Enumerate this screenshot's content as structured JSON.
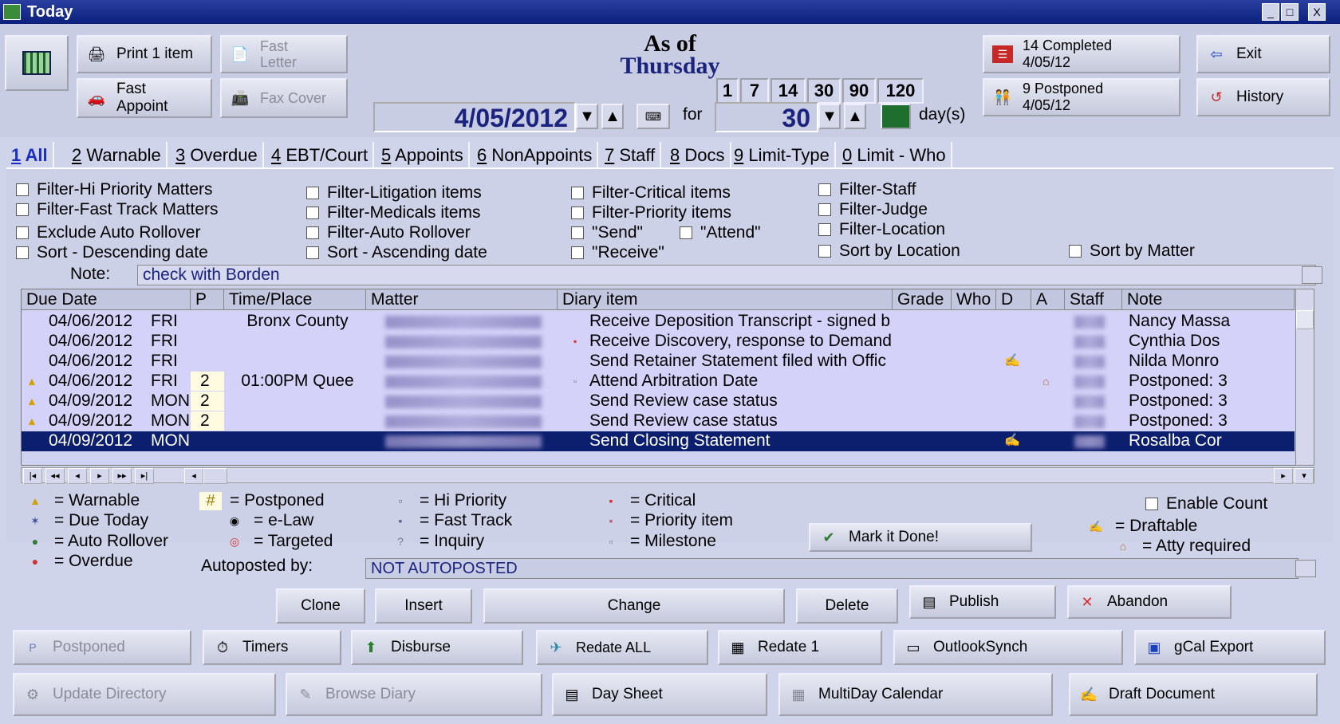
{
  "window": {
    "title": "Today",
    "minimize": "_",
    "maximize": "□",
    "close": "X"
  },
  "toolbar": {
    "print_label": "Print 1 item",
    "fast_letter_label": "Fast Letter",
    "fast_appoint_label": "Fast Appoint",
    "fax_cover_label": "Fax Cover",
    "as_of_label": "As of",
    "weekday": "Thursday",
    "date_value": "4/05/2012",
    "for_label": "for",
    "days_value": "30",
    "days_label": "day(s)",
    "quick_days": [
      "1",
      "7",
      "14",
      "30",
      "90",
      "120"
    ],
    "completed_label": "14 Completed",
    "completed_date": "4/05/12",
    "postponed_label": "9 Postponed",
    "postponed_date": "4/05/12",
    "exit_label": "Exit",
    "history_label": "History"
  },
  "tabs": [
    {
      "num": "1",
      "label": "All",
      "active": true
    },
    {
      "num": "2",
      "label": "Warnable"
    },
    {
      "num": "3",
      "label": "Overdue"
    },
    {
      "num": "4",
      "label": "EBT/Court"
    },
    {
      "num": "5",
      "label": "Appoints"
    },
    {
      "num": "6",
      "label": "NonAppoints"
    },
    {
      "num": "7",
      "label": "Staff"
    },
    {
      "num": "8",
      "label": "Docs"
    },
    {
      "num": "9",
      "label": "Limit-Type"
    },
    {
      "num": "0",
      "label": "Limit - Who"
    }
  ],
  "filters": {
    "hi_priority": "Filter-Hi Priority Matters",
    "fast_track": "Filter-Fast Track Matters",
    "exclude_auto": "Exclude Auto Rollover",
    "sort_desc": "Sort - Descending date",
    "litigation": "Filter-Litigation items",
    "medicals": "Filter-Medicals items",
    "auto_rollover": "Filter-Auto Rollover",
    "sort_asc": "Sort - Ascending date",
    "critical": "Filter-Critical items",
    "priority": "Filter-Priority items",
    "send": "\"Send\"",
    "attend": "\"Attend\"",
    "receive": "\"Receive\"",
    "staff": "Filter-Staff",
    "judge": "Filter-Judge",
    "location": "Filter-Location",
    "sort_location": "Sort by Location",
    "sort_matter": "Sort by Matter"
  },
  "note": {
    "label": "Note:",
    "value": "check with Borden"
  },
  "grid": {
    "columns": [
      "Due Date",
      "P",
      "Time/Place",
      "Matter",
      "Diary item",
      "Grade",
      "Who",
      "D",
      "A",
      "Staff",
      "Note"
    ],
    "rows": [
      {
        "date": "04/06/2012",
        "day": "FRI",
        "p": "",
        "time": "Bronx County",
        "item": "Receive Deposition Transcript - signed b",
        "note": "Nancy Massa",
        "icon": ""
      },
      {
        "date": "04/06/2012",
        "day": "FRI",
        "p": "",
        "time": "",
        "item": "Receive Discovery, response to Demand",
        "note": "Cynthia Dos",
        "icon": "critical"
      },
      {
        "date": "04/06/2012",
        "day": "FRI",
        "p": "",
        "time": "",
        "item": "Send Retainer Statement filed with Offic",
        "note": "Nilda Monro",
        "icon": "",
        "d": "draftable"
      },
      {
        "date": "04/06/2012",
        "day": "FRI",
        "p": "2",
        "time": "01:00PM Quee",
        "item": "Attend Arbitration Date",
        "note": "Postponed: 3",
        "icon": "milestone",
        "warn": true,
        "a": "atty"
      },
      {
        "date": "04/09/2012",
        "day": "MON",
        "p": "2",
        "time": "",
        "item": "Send Review case status",
        "note": "Postponed: 3",
        "warn": true
      },
      {
        "date": "04/09/2012",
        "day": "MON",
        "p": "2",
        "time": "",
        "item": "Send Review case status",
        "note": "Postponed: 3",
        "warn": true
      },
      {
        "date": "04/09/2012",
        "day": "MON",
        "p": "",
        "time": "",
        "item": "Send Closing Statement",
        "note": "Rosalba Cor",
        "selected": true,
        "d": "draftable"
      }
    ]
  },
  "legend": {
    "warnable": "= Warnable",
    "due_today": "= Due Today",
    "auto_rollover": "= Auto Rollover",
    "overdue": "= Overdue",
    "postponed_sym": "#",
    "postponed": "= Postponed",
    "elaw": "= e-Law",
    "targeted": "= Targeted",
    "hi_priority": "= Hi Priority",
    "fast_track": "= Fast Track",
    "inquiry": "= Inquiry",
    "critical": "= Critical",
    "priority_item": "= Priority item",
    "milestone": "= Milestone",
    "enable_count": "Enable Count",
    "draftable": "= Draftable",
    "atty_required": "= Atty required",
    "mark_done": "Mark it Done!"
  },
  "autoposted": {
    "label": "Autoposted by:",
    "value": "NOT AUTOPOSTED"
  },
  "actions": {
    "clone": "Clone",
    "insert": "Insert",
    "change": "Change",
    "delete": "Delete",
    "publish": "Publish",
    "abandon": "Abandon",
    "postponed": "Postponed",
    "timers": "Timers",
    "disburse": "Disburse",
    "redate_all": "Redate ALL",
    "redate_1": "Redate 1",
    "outlook_synch": "OutlookSynch",
    "gcal_export": "gCal Export",
    "update_directory": "Update Directory",
    "browse_diary": "Browse Diary",
    "day_sheet": "Day Sheet",
    "multiday_calendar": "MultiDay Calendar",
    "draft_document": "Draft Document"
  },
  "colors": {
    "accent": "#1a2fbf",
    "selection": "#0c1f6e",
    "grid_bg": "#d4d2f8",
    "critical": "#d32f2f",
    "warn": "#e0a000"
  }
}
